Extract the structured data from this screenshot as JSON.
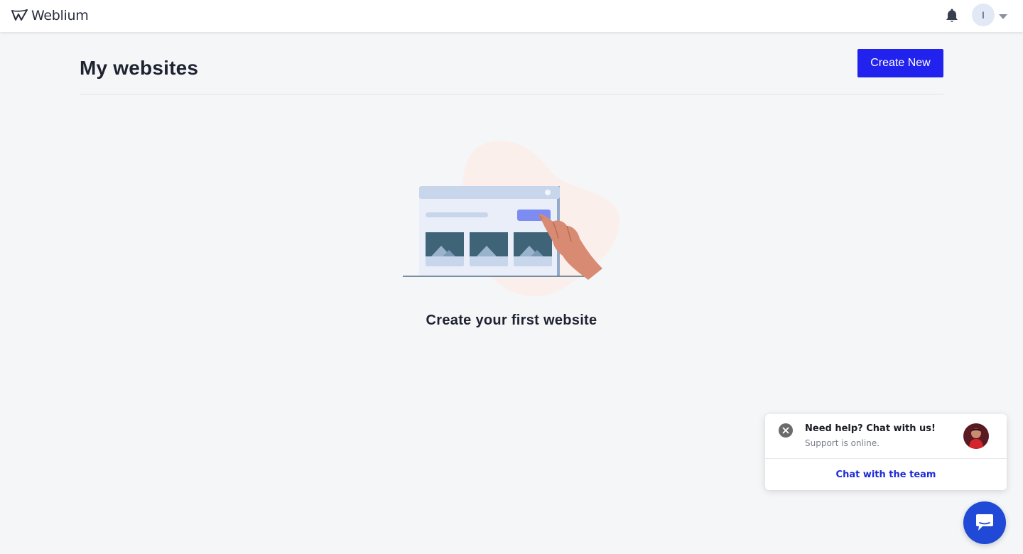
{
  "app": {
    "logo_text": "Weblium"
  },
  "topbar": {
    "bell_icon": "bell-icon",
    "user_initial": "I",
    "caret_icon": "caret-down-icon"
  },
  "main": {
    "title": "My websites",
    "create_button_label": "Create New",
    "empty_state_text": "Create your first website"
  },
  "chat_widget": {
    "title": "Need help? Chat with us!",
    "subtitle": "Support is online.",
    "link_label": "Chat with the team",
    "close_icon": "close-icon",
    "launcher_icon": "chat-bubble-icon"
  },
  "colors": {
    "accent": "#2222ee",
    "chat_link": "#1d2bd6",
    "launcher": "#1f49d6",
    "page_bg": "#f5f6f8"
  }
}
